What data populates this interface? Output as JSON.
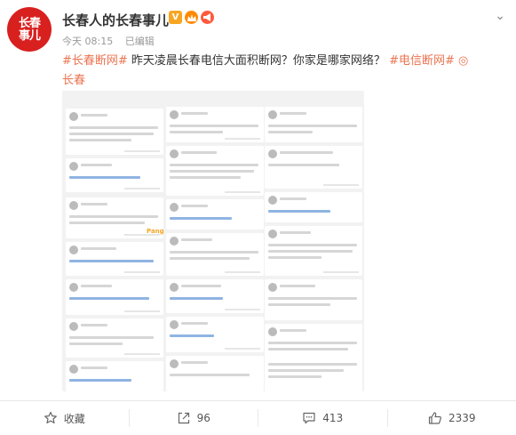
{
  "header": {
    "logo_line1": "长春",
    "logo_line2": "事儿",
    "username": "长春人的长春事儿",
    "badge_v": "V",
    "time": "今天 08:15",
    "edited": "已编辑",
    "more_symbol": "⌄"
  },
  "post": {
    "hashtag1": "#长春断网#",
    "text1": " 昨天凌晨长春电信大面积断网？你家是哪家网络？ ",
    "hashtag2": "#电信断网#",
    "location_icon": "◎",
    "location": "长春"
  },
  "image": {
    "sticker": "Pang"
  },
  "footer": {
    "favorite_label": "收藏",
    "repost_count": "96",
    "comment_count": "413",
    "like_count": "2339"
  },
  "colors": {
    "accent": "#eb7350",
    "logo_red": "#d8201f",
    "text": "#333333",
    "meta": "#999999"
  }
}
